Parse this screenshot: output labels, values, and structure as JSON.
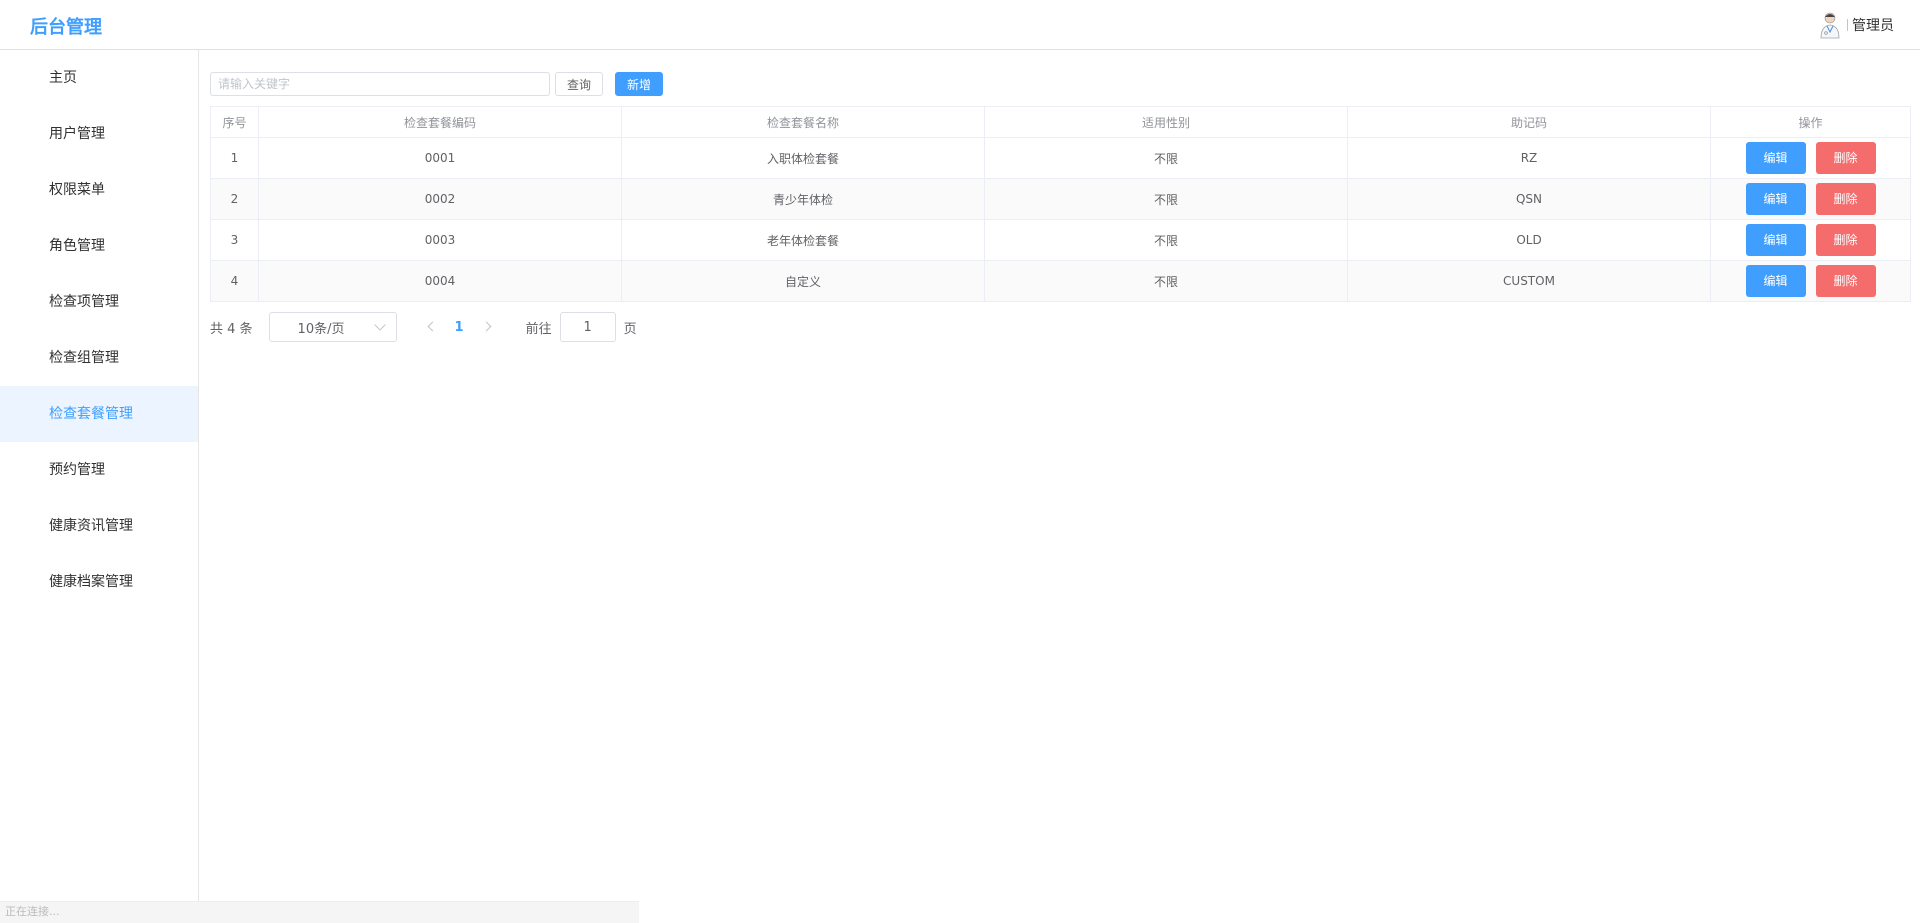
{
  "header": {
    "title": "后台管理",
    "user_name": "管理员",
    "avatar_icon": "doctor-avatar-icon"
  },
  "sidebar": {
    "active_index": 6,
    "items": [
      {
        "label": "主页"
      },
      {
        "label": "用户管理"
      },
      {
        "label": "权限菜单"
      },
      {
        "label": "角色管理"
      },
      {
        "label": "检查项管理"
      },
      {
        "label": "检查组管理"
      },
      {
        "label": "检查套餐管理"
      },
      {
        "label": "预约管理"
      },
      {
        "label": "健康资讯管理"
      },
      {
        "label": "健康档案管理"
      }
    ]
  },
  "toolbar": {
    "search_placeholder": "请输入关键字",
    "search_value": "",
    "query_label": "查询",
    "add_label": "新增"
  },
  "table": {
    "columns": [
      "序号",
      "检查套餐编码",
      "检查套餐名称",
      "适用性别",
      "助记码",
      "操作"
    ],
    "edit_label": "编辑",
    "delete_label": "删除",
    "rows": [
      {
        "index": "1",
        "code": "0001",
        "name": "入职体检套餐",
        "gender": "不限",
        "mnemonic": "RZ"
      },
      {
        "index": "2",
        "code": "0002",
        "name": "青少年体检",
        "gender": "不限",
        "mnemonic": "QSN"
      },
      {
        "index": "3",
        "code": "0003",
        "name": "老年体检套餐",
        "gender": "不限",
        "mnemonic": "OLD"
      },
      {
        "index": "4",
        "code": "0004",
        "name": "自定义",
        "gender": "不限",
        "mnemonic": "CUSTOM"
      }
    ]
  },
  "pagination": {
    "total_text": "共 4 条",
    "page_size": "10条/页",
    "current_page": "1",
    "goto_label": "前往",
    "goto_value": "1",
    "goto_suffix": "页"
  },
  "statusbar": {
    "text": "正在连接..."
  },
  "colors": {
    "primary": "#409eff",
    "danger": "#f56c6c",
    "active_bg": "#ecf5ff"
  }
}
